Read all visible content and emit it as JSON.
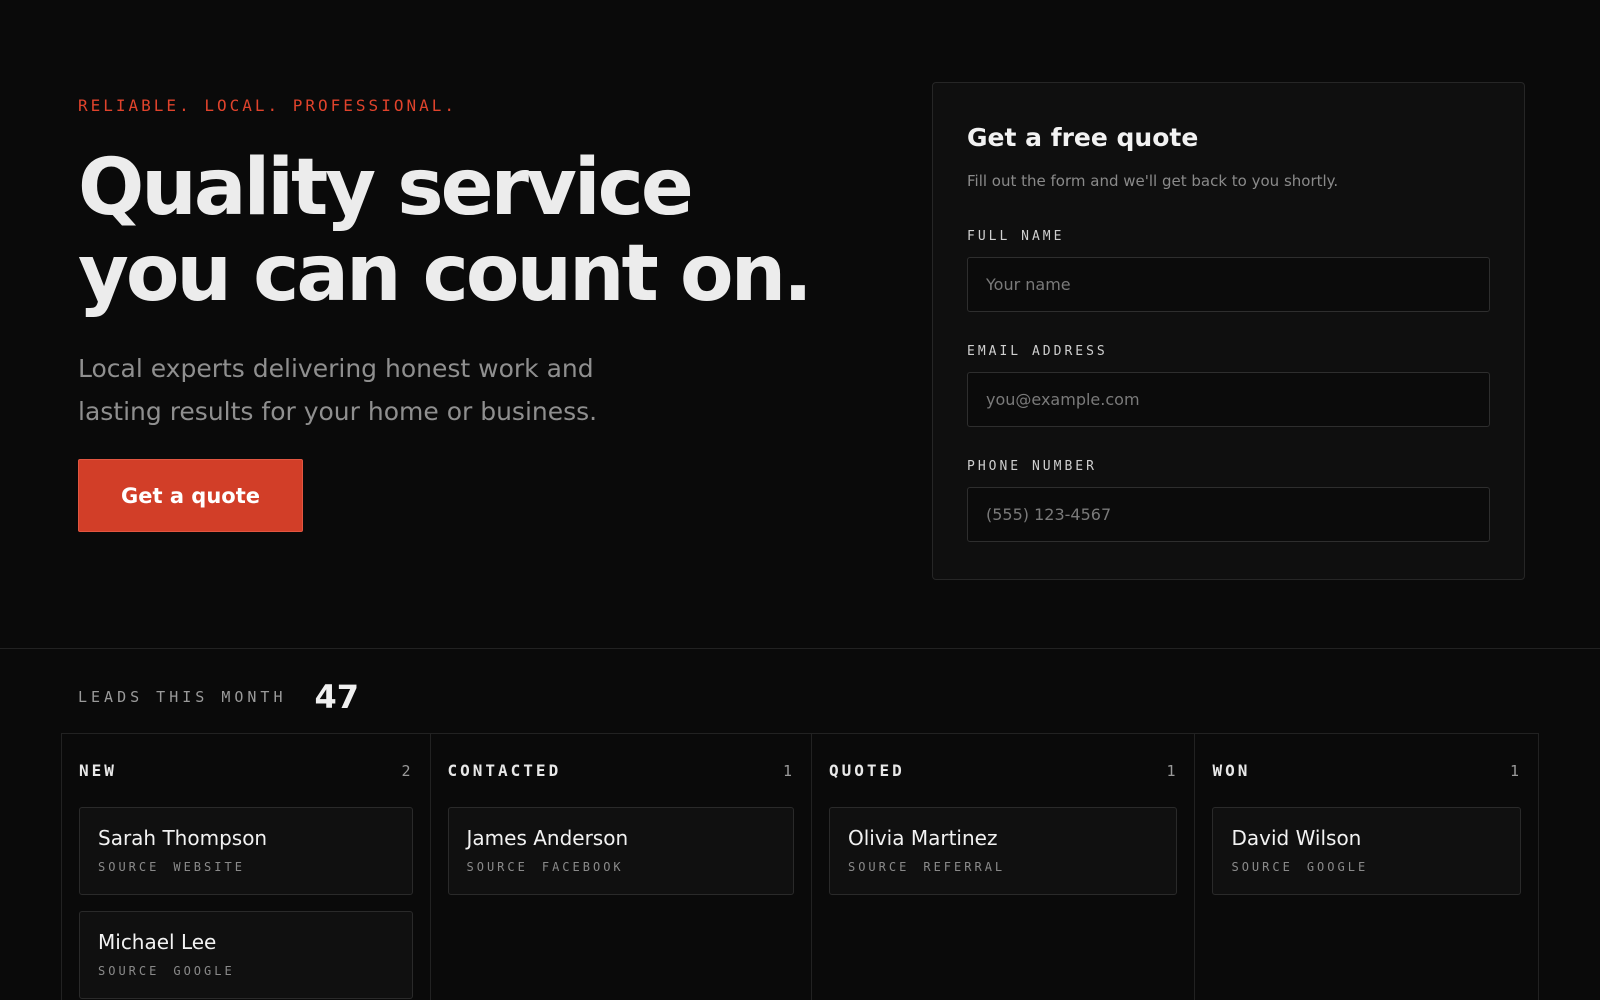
{
  "hero": {
    "eyebrow": "RELIABLE. LOCAL. PROFESSIONAL.",
    "headline_line1": "Quality service",
    "headline_line2": "you can count on.",
    "subhead": "Local experts delivering honest work and lasting results for your home or business.",
    "cta_label": "Get a quote"
  },
  "quote_form": {
    "title": "Get a free quote",
    "subtitle": "Fill out the form and we'll get back to you shortly.",
    "fields": [
      {
        "label": "FULL NAME",
        "placeholder": "Your name"
      },
      {
        "label": "EMAIL ADDRESS",
        "placeholder": "you@example.com"
      },
      {
        "label": "PHONE NUMBER",
        "placeholder": "(555) 123-4567"
      }
    ]
  },
  "leads": {
    "label": "LEADS THIS MONTH",
    "count": "47",
    "columns": [
      {
        "title": "NEW",
        "count": "2",
        "cards": [
          {
            "name": "Sarah Thompson",
            "source_label": "SOURCE",
            "source": "WEBSITE"
          },
          {
            "name": "Michael Lee",
            "source_label": "SOURCE",
            "source": "GOOGLE"
          }
        ]
      },
      {
        "title": "CONTACTED",
        "count": "1",
        "cards": [
          {
            "name": "James Anderson",
            "source_label": "SOURCE",
            "source": "FACEBOOK"
          }
        ]
      },
      {
        "title": "QUOTED",
        "count": "1",
        "cards": [
          {
            "name": "Olivia Martinez",
            "source_label": "SOURCE",
            "source": "REFERRAL"
          }
        ]
      },
      {
        "title": "WON",
        "count": "1",
        "cards": [
          {
            "name": "David Wilson",
            "source_label": "SOURCE",
            "source": "GOOGLE"
          }
        ]
      }
    ]
  },
  "colors": {
    "accent": "#d23e28",
    "background": "#0a0a0a"
  }
}
